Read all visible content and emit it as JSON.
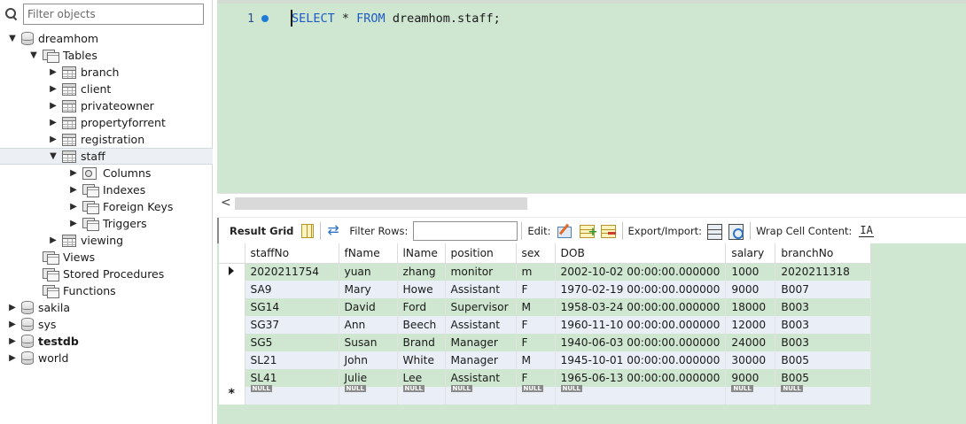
{
  "navigator": {
    "filter_placeholder": "Filter objects",
    "tree": [
      {
        "label": "dreamhom",
        "icon": "database-icon",
        "arrow": "▼",
        "depth": 0
      },
      {
        "label": "Tables",
        "icon": "tables-group-icon",
        "arrow": "▼",
        "depth": 1
      },
      {
        "label": "branch",
        "icon": "table-icon",
        "arrow": "▶",
        "depth": 2
      },
      {
        "label": "client",
        "icon": "table-icon",
        "arrow": "▶",
        "depth": 2
      },
      {
        "label": "privateowner",
        "icon": "table-icon",
        "arrow": "▶",
        "depth": 2
      },
      {
        "label": "propertyforrent",
        "icon": "table-icon",
        "arrow": "▶",
        "depth": 2
      },
      {
        "label": "registration",
        "icon": "table-icon",
        "arrow": "▶",
        "depth": 2
      },
      {
        "label": "staff",
        "icon": "table-icon",
        "arrow": "▼",
        "depth": 2,
        "selected": true
      },
      {
        "label": "Columns",
        "icon": "columns-icon",
        "arrow": "▶",
        "depth": 3
      },
      {
        "label": "Indexes",
        "icon": "indexes-icon",
        "arrow": "▶",
        "depth": 3
      },
      {
        "label": "Foreign Keys",
        "icon": "foreign-keys-icon",
        "arrow": "▶",
        "depth": 3
      },
      {
        "label": "Triggers",
        "icon": "triggers-icon",
        "arrow": "▶",
        "depth": 3
      },
      {
        "label": "viewing",
        "icon": "table-icon",
        "arrow": "▶",
        "depth": 2
      },
      {
        "label": "Views",
        "icon": "views-group-icon",
        "arrow": "",
        "depth": 1
      },
      {
        "label": "Stored Procedures",
        "icon": "procedures-group-icon",
        "arrow": "",
        "depth": 1
      },
      {
        "label": "Functions",
        "icon": "functions-group-icon",
        "arrow": "",
        "depth": 1
      },
      {
        "label": "sakila",
        "icon": "database-icon",
        "arrow": "▶",
        "depth": 0
      },
      {
        "label": "sys",
        "icon": "database-icon",
        "arrow": "▶",
        "depth": 0
      },
      {
        "label": "testdb",
        "icon": "database-icon",
        "arrow": "▶",
        "depth": 0,
        "bold": true
      },
      {
        "label": "world",
        "icon": "database-icon",
        "arrow": "▶",
        "depth": 0
      }
    ]
  },
  "editor": {
    "line_number": "1",
    "code": {
      "kw1": "SELECT",
      "mid": " * ",
      "kw2": "FROM",
      "rest": " dreamhom.staff;"
    }
  },
  "scroll": {
    "left_arrow": "<"
  },
  "toolbar": {
    "result_grid_label": "Result Grid",
    "filter_rows_label": "Filter Rows:",
    "edit_label": "Edit:",
    "export_import_label": "Export/Import:",
    "wrap_cell_label": "Wrap Cell Content:",
    "wrap_glyph": "IA"
  },
  "grid": {
    "columns": [
      "staffNo",
      "fName",
      "lName",
      "position",
      "sex",
      "DOB",
      "salary",
      "branchNo"
    ],
    "rows": [
      [
        "2020211754",
        "yuan",
        "zhang",
        "monitor",
        "m",
        "2002-10-02 00:00:00.000000",
        "1000",
        "2020211318"
      ],
      [
        "SA9",
        "Mary",
        "Howe",
        "Assistant",
        "F",
        "1970-02-19 00:00:00.000000",
        "9000",
        "B007"
      ],
      [
        "SG14",
        "David",
        "Ford",
        "Supervisor",
        "M",
        "1958-03-24 00:00:00.000000",
        "18000",
        "B003"
      ],
      [
        "SG37",
        "Ann",
        "Beech",
        "Assistant",
        "F",
        "1960-11-10 00:00:00.000000",
        "12000",
        "B003"
      ],
      [
        "SG5",
        "Susan",
        "Brand",
        "Manager",
        "F",
        "1940-06-03 00:00:00.000000",
        "24000",
        "B003"
      ],
      [
        "SL21",
        "John",
        "White",
        "Manager",
        "M",
        "1945-10-01 00:00:00.000000",
        "30000",
        "B005"
      ],
      [
        "SL41",
        "Julie",
        "Lee",
        "Assistant",
        "F",
        "1965-06-13 00:00:00.000000",
        "9000",
        "B005"
      ]
    ],
    "null_label": "NULL",
    "current_row_marker": "▶",
    "new_row_marker": "*"
  }
}
